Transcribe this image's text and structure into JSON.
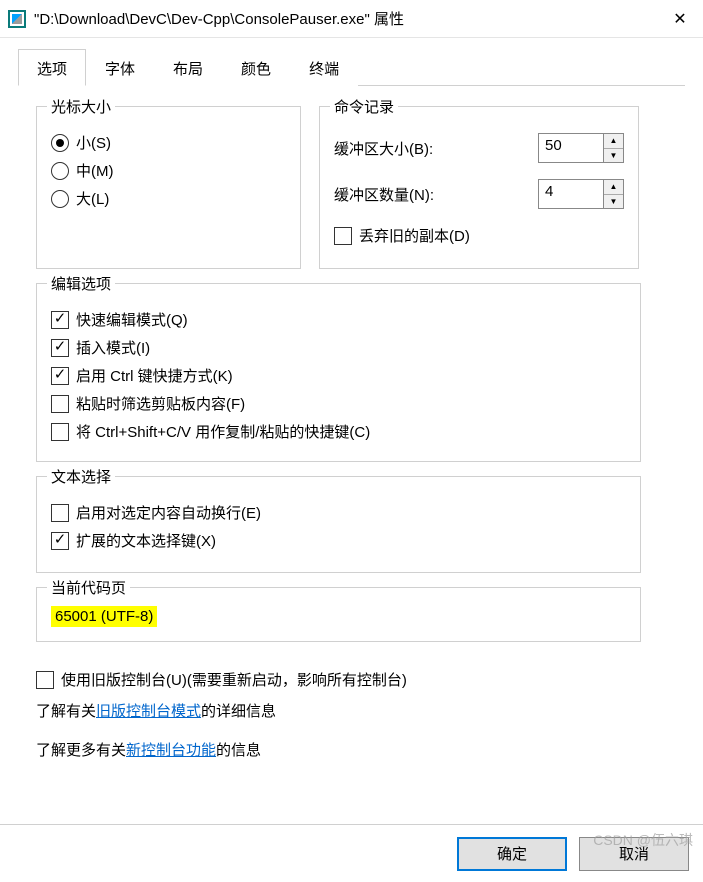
{
  "window": {
    "title": "\"D:\\Download\\DevC\\Dev-Cpp\\ConsolePauser.exe\" 属性"
  },
  "tabs": {
    "options": "选项",
    "font": "字体",
    "layout": "布局",
    "color": "颜色",
    "terminal": "终端"
  },
  "cursor": {
    "legend": "光标大小",
    "small": "小(S)",
    "medium": "中(M)",
    "large": "大(L)"
  },
  "cmd": {
    "legend": "命令记录",
    "buffer_size_label": "缓冲区大小(B):",
    "buffer_size_value": "50",
    "buffer_count_label": "缓冲区数量(N):",
    "buffer_count_value": "4",
    "discard_old": "丢弃旧的副本(D)"
  },
  "edit": {
    "legend": "编辑选项",
    "quick_edit": "快速编辑模式(Q)",
    "insert_mode": "插入模式(I)",
    "ctrl_shortcuts": "启用 Ctrl 键快捷方式(K)",
    "filter_clipboard": "粘贴时筛选剪贴板内容(F)",
    "ctrl_shift_cv": "将 Ctrl+Shift+C/V 用作复制/粘贴的快捷键(C)"
  },
  "textsel": {
    "legend": "文本选择",
    "wrap": "启用对选定内容自动换行(E)",
    "extended": "扩展的文本选择键(X)"
  },
  "codepage": {
    "legend": "当前代码页",
    "value": "65001 (UTF-8)"
  },
  "bottom": {
    "legacy_console": "使用旧版控制台(U)(需要重新启动，影响所有控制台)",
    "learn_legacy_pre": "了解有关",
    "learn_legacy_link": "旧版控制台模式",
    "learn_legacy_post": "的详细信息",
    "learn_new_pre": "了解更多有关",
    "learn_new_link": "新控制台功能",
    "learn_new_post": "的信息"
  },
  "buttons": {
    "ok": "确定",
    "cancel": "取消"
  },
  "watermark": "CSDN @伍六琪"
}
